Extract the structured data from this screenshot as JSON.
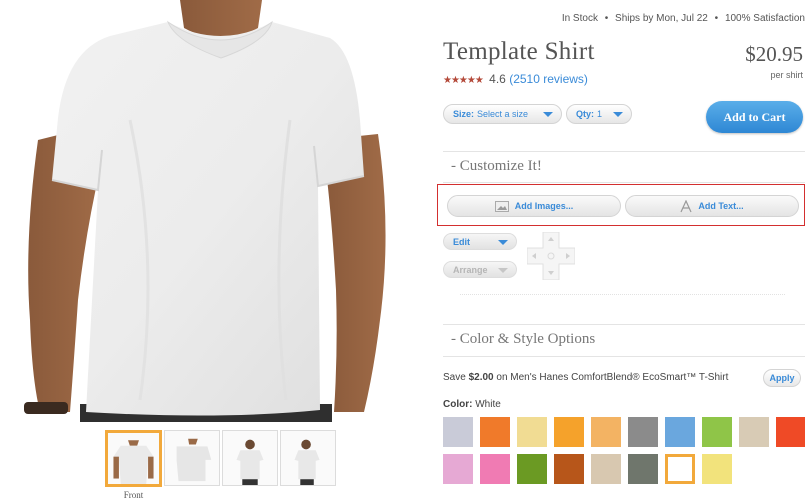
{
  "toolbar": {
    "tools": [
      "collapse-up-icon",
      "close-icon",
      "fit-screen-icon",
      "undo-icon",
      "redo-icon"
    ]
  },
  "thumbnails": {
    "items": [
      "front-view",
      "side-view",
      "back-view",
      "other-side-view"
    ],
    "selected_index": 0,
    "selected_label": "Front"
  },
  "shipping": {
    "status": "In Stock",
    "ships": "Ships by Mon, Jul 22",
    "satisfaction": "100% Satisfaction",
    "separator": "•"
  },
  "product": {
    "title": "Template Shirt",
    "price": "$20.95",
    "price_unit": "per shirt",
    "rating_stars": "★★★★★",
    "rating_value": "4.6",
    "reviews": "(2510 reviews)"
  },
  "options": {
    "size_label": "Size:",
    "size_value": "Select a size",
    "qty_label": "Qty:",
    "qty_value": "1",
    "add_to_cart": "Add to Cart"
  },
  "customize": {
    "heading": "- Customize It!",
    "add_images": "Add Images...",
    "add_text": "Add Text...",
    "edit": "Edit",
    "arrange": "Arrange"
  },
  "color_style": {
    "heading": "- Color & Style Options",
    "save_prefix": "Save ",
    "save_amount": "$2.00",
    "save_suffix": " on Men's Hanes ComfortBlend® EcoSmart™ T-Shirt",
    "apply": "Apply",
    "color_label": "Color:",
    "color_value": "White",
    "selected_swatch": 16,
    "swatches": [
      "#c9cbd8",
      "#f07a2a",
      "#f1dc93",
      "#f5a22b",
      "#f3b363",
      "#8b8b8b",
      "#6aa7de",
      "#8fc548",
      "#d8cbb5",
      "#ef4a26",
      "#e6a9d4",
      "#f07bb3",
      "#6b9a23",
      "#b7561a",
      "#d8c8b0",
      "#6f766c",
      "#ffffff",
      "#f2e37c"
    ]
  },
  "colors": {
    "accent_blue": "#3a8bd8",
    "star_red": "#b44a3a",
    "selection_orange": "#f2a93b",
    "highlight_red": "#d32f2f"
  }
}
